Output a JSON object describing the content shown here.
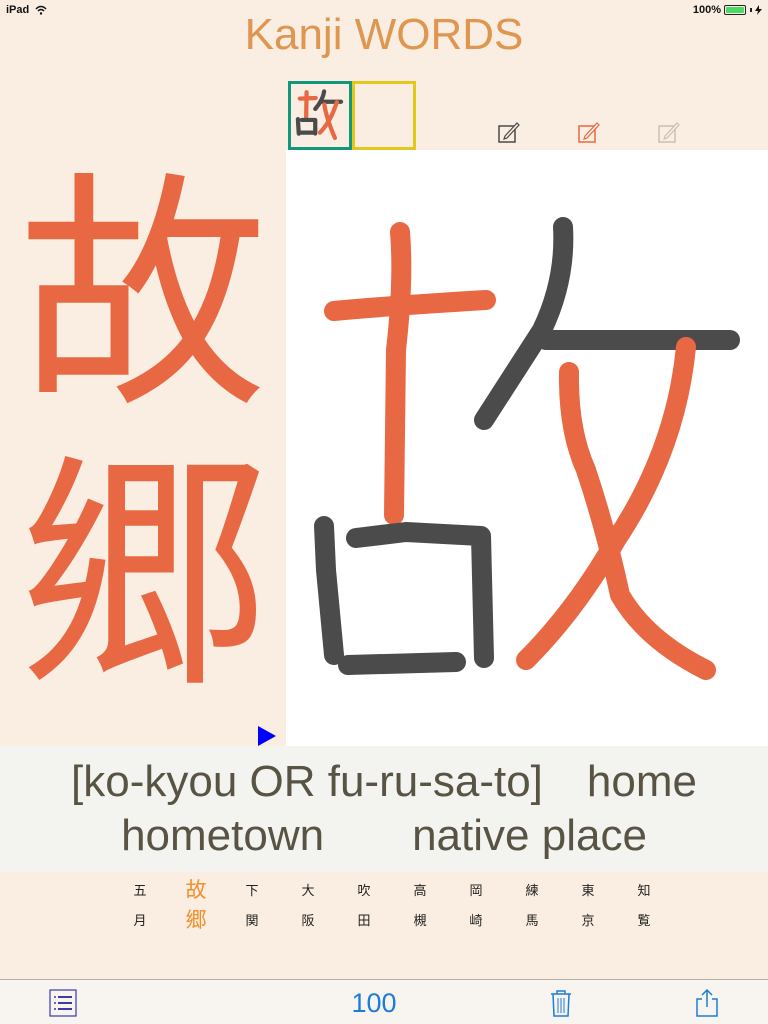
{
  "status_bar": {
    "device": "iPad",
    "battery_percent": "100%",
    "wifi_icon": "wifi-icon",
    "battery_icon": "battery-full-icon",
    "charging_icon": "charging-bolt-icon"
  },
  "app": {
    "title": "Kanji WORDS",
    "title_color": "#df9650"
  },
  "practice": {
    "current_kanji": "故",
    "next_kanji": "",
    "current_box_color": "#12977c",
    "next_box_color": "#e3c71a",
    "pen_tools": [
      {
        "name": "edit-dark",
        "color": "#4a4a4a"
      },
      {
        "name": "edit-orange",
        "color": "#e86843"
      },
      {
        "name": "edit-light",
        "color": "#c9bfb5"
      }
    ],
    "stroke_colors": {
      "orange": "#e86843",
      "dark": "#4b4b4b"
    }
  },
  "word": {
    "kanji": [
      "故",
      "郷"
    ],
    "kanji_color": "#e86843",
    "reading": "[ko-kyou OR fu-ru-sa-to]",
    "meaning_line1_suffix": "home",
    "meaning_line2": "hometown  native place"
  },
  "word_list": [
    {
      "top": "五",
      "bottom": "月",
      "selected": false
    },
    {
      "top": "故",
      "bottom": "郷",
      "selected": true
    },
    {
      "top": "下",
      "bottom": "関",
      "selected": false
    },
    {
      "top": "大",
      "bottom": "阪",
      "selected": false
    },
    {
      "top": "吹",
      "bottom": "田",
      "selected": false
    },
    {
      "top": "高",
      "bottom": "槻",
      "selected": false
    },
    {
      "top": "岡",
      "bottom": "崎",
      "selected": false
    },
    {
      "top": "練",
      "bottom": "馬",
      "selected": false
    },
    {
      "top": "東",
      "bottom": "京",
      "selected": false
    },
    {
      "top": "知",
      "bottom": "覧",
      "selected": false
    }
  ],
  "toolbar": {
    "count": "100",
    "list_icon": "list-icon",
    "trash_icon": "trash-icon",
    "share_icon": "share-icon",
    "accent": "#1c7dd8"
  }
}
